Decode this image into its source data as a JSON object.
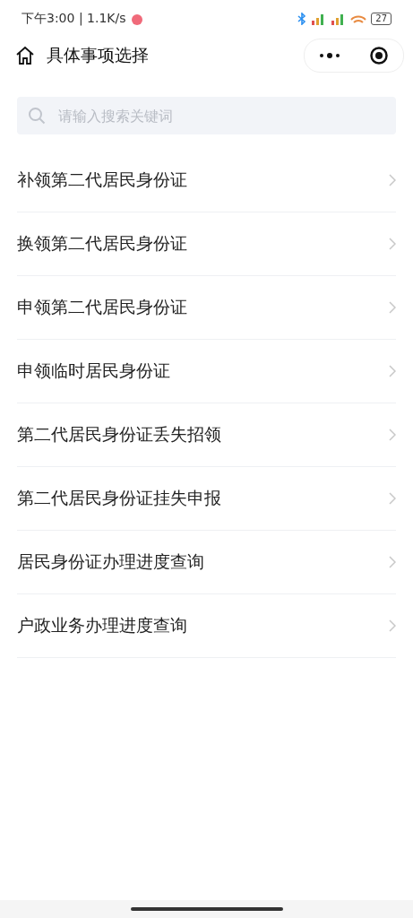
{
  "status_bar": {
    "time": "下午3:00 | 1.1K/s",
    "battery": "27"
  },
  "header": {
    "title": "具体事项选择"
  },
  "search": {
    "placeholder": "请输入搜索关键词"
  },
  "items": [
    {
      "label": "补领第二代居民身份证"
    },
    {
      "label": "换领第二代居民身份证"
    },
    {
      "label": "申领第二代居民身份证"
    },
    {
      "label": "申领临时居民身份证"
    },
    {
      "label": "第二代居民身份证丢失招领"
    },
    {
      "label": "第二代居民身份证挂失申报"
    },
    {
      "label": "居民身份证办理进度查询"
    },
    {
      "label": "户政业务办理进度查询"
    }
  ]
}
